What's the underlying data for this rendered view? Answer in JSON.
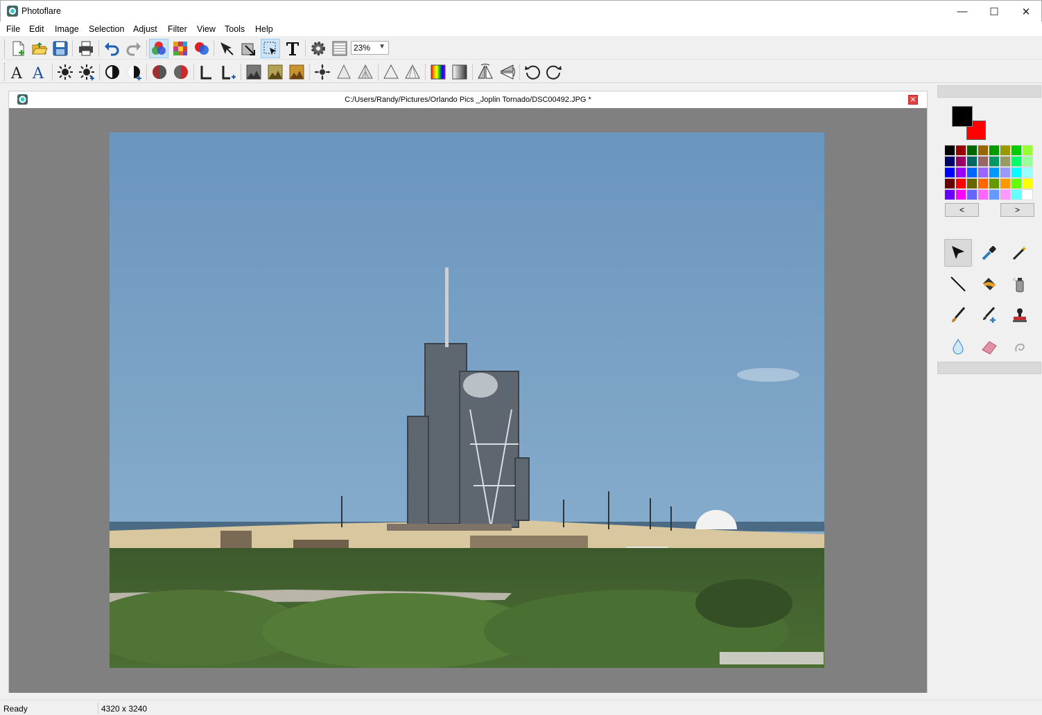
{
  "app": {
    "title": "Photoflare"
  },
  "window_controls": {
    "minimize": "—",
    "maximize": "☐",
    "close": "✕"
  },
  "menu": [
    "File",
    "Edit",
    "Image",
    "Selection",
    "Adjust",
    "Filter",
    "View",
    "Tools",
    "Help"
  ],
  "toolbar": {
    "zoom_value": "23%"
  },
  "document": {
    "path": "C:/Users/Randy/Pictures/Orlando Pics _Joplin Tornado/DSC00492.JPG *",
    "close_glyph": "✕"
  },
  "colors": {
    "primary": "#000000",
    "secondary": "#ff0000",
    "palette": [
      "#000000",
      "#990000",
      "#006600",
      "#996600",
      "#009900",
      "#999900",
      "#00cc00",
      "#99ff33",
      "#000066",
      "#990066",
      "#006666",
      "#996666",
      "#009966",
      "#999966",
      "#00ff66",
      "#99ff99",
      "#0000ff",
      "#9900ff",
      "#0066ff",
      "#9966ff",
      "#0099ff",
      "#9999ff",
      "#00ffff",
      "#99ffff",
      "#660000",
      "#ff0000",
      "#666600",
      "#ff6600",
      "#669900",
      "#ff9900",
      "#66ff00",
      "#ffff00",
      "#6600ff",
      "#ff00ff",
      "#6666ff",
      "#ff66ff",
      "#6699ff",
      "#ff99ff",
      "#66ffff",
      "#ffffff"
    ]
  },
  "palette_nav": {
    "prev": "<",
    "next": ">"
  },
  "status": {
    "text": "Ready",
    "image_size": "4320 x 3240"
  }
}
